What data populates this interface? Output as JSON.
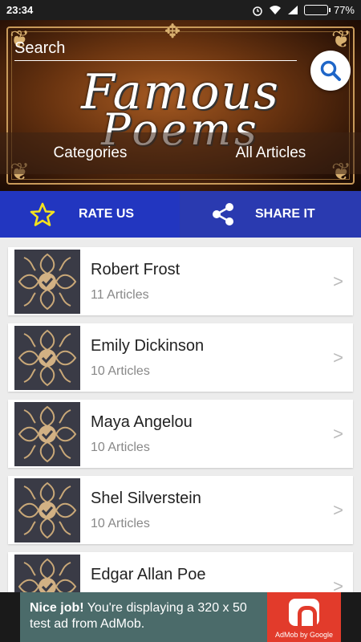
{
  "status": {
    "time": "23:34",
    "battery": "77%",
    "battery_level": 0.77
  },
  "header": {
    "search_label": "Search",
    "logo_line1": "Famous",
    "logo_line2": "Poems",
    "tabs": [
      {
        "label": "Categories"
      },
      {
        "label": "All Articles"
      }
    ]
  },
  "actions": {
    "rate": {
      "label": "RATE US",
      "icon": "star-icon"
    },
    "share": {
      "label": "SHARE IT",
      "icon": "share-icon"
    }
  },
  "authors": [
    {
      "name": "Robert Frost",
      "count": "11 Articles"
    },
    {
      "name": "Emily Dickinson",
      "count": "10 Articles"
    },
    {
      "name": "Maya Angelou",
      "count": "10 Articles"
    },
    {
      "name": "Shel Silverstein",
      "count": "10 Articles"
    },
    {
      "name": "Edgar Allan Poe",
      "count": ""
    }
  ],
  "chevron": ">",
  "ad": {
    "headline": "Nice job!",
    "body": " You're displaying a 320 x 50 test ad from AdMob.",
    "byline": "AdMob by Google"
  },
  "colors": {
    "action_rate": "#2236c0",
    "action_share": "#2a3ab0",
    "star": "#f4e21e",
    "ad_bg": "#4b6b6a",
    "ad_logo": "#e23b2b"
  }
}
